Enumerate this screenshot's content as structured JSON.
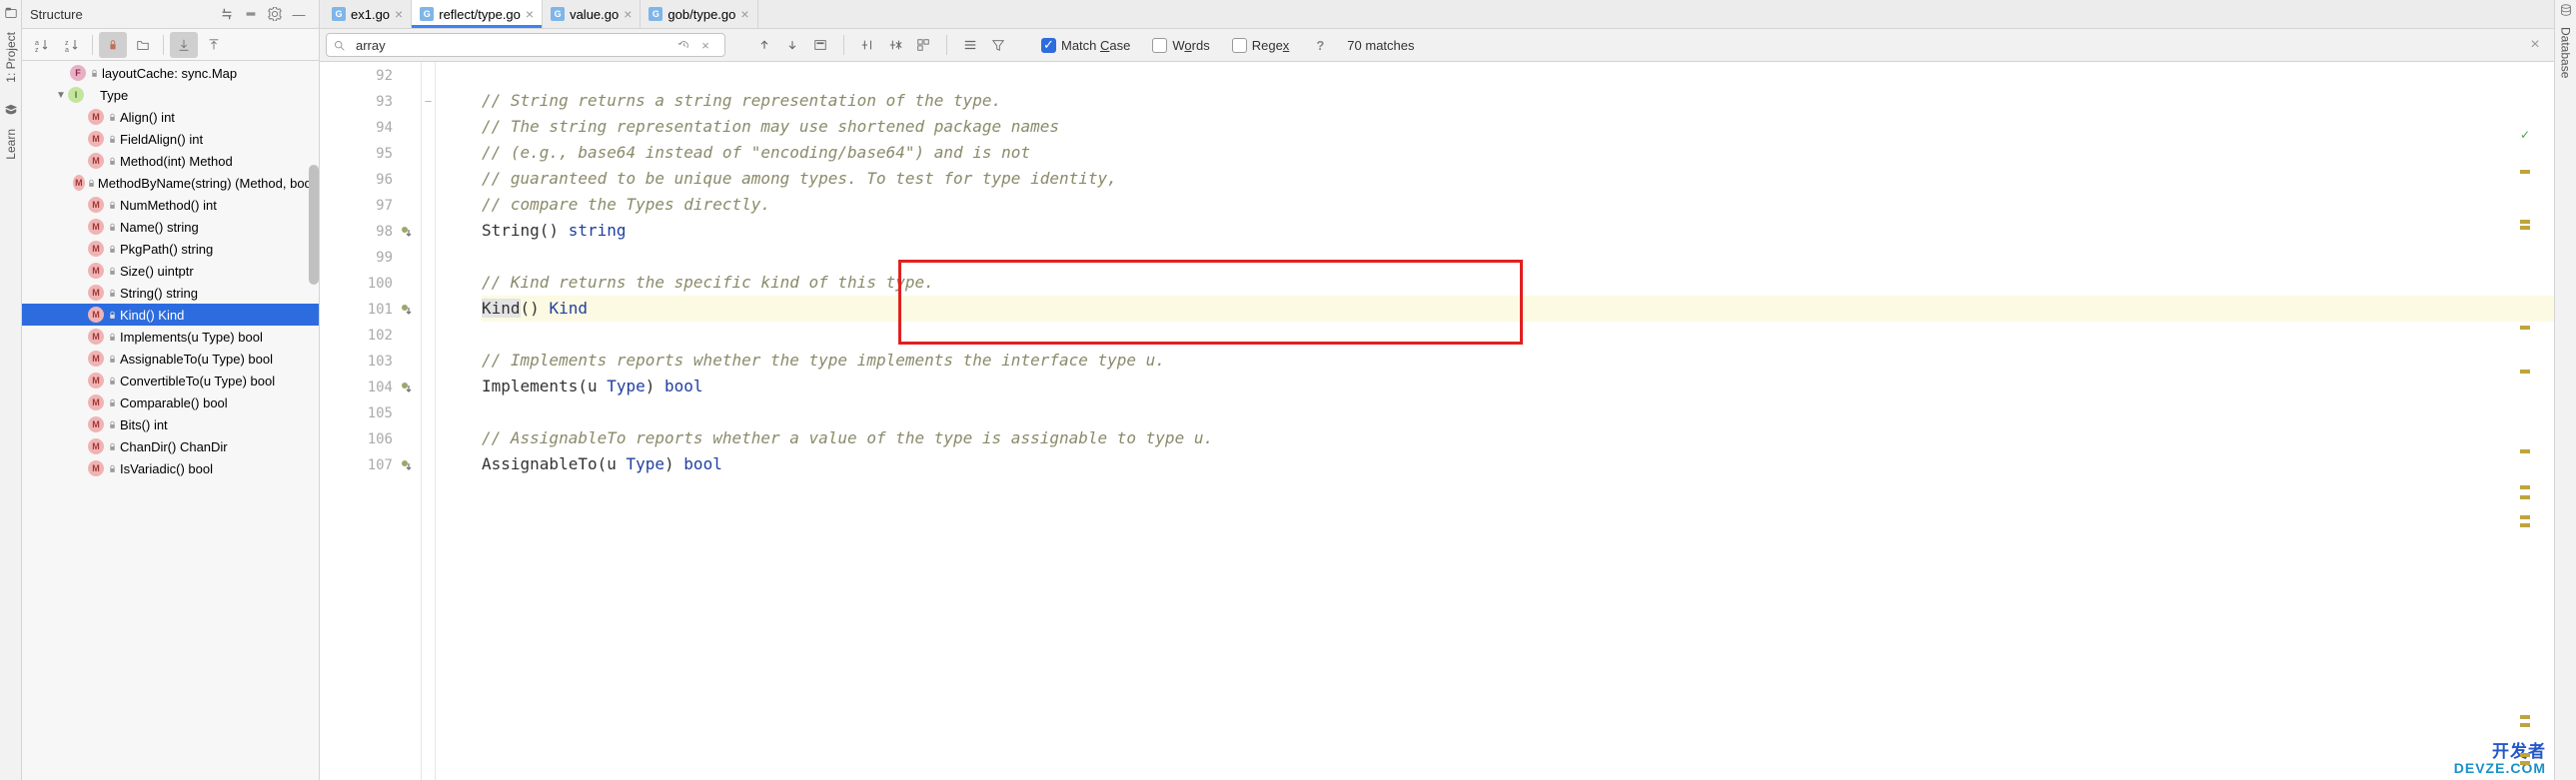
{
  "leftStrip": [
    "1: Project",
    "Learn"
  ],
  "rightStrip": [
    "Database"
  ],
  "structure": {
    "title": "Structure",
    "items": [
      {
        "indent": 28,
        "arrow": "",
        "icon": "f",
        "label": "layoutCache: sync.Map",
        "lock": true
      },
      {
        "indent": 26,
        "arrow": "▼",
        "icon": "i",
        "label": "Type",
        "lock": false
      },
      {
        "indent": 46,
        "arrow": "",
        "icon": "m",
        "label": "Align() int",
        "lock": true
      },
      {
        "indent": 46,
        "arrow": "",
        "icon": "m",
        "label": "FieldAlign() int",
        "lock": true
      },
      {
        "indent": 46,
        "arrow": "",
        "icon": "m",
        "label": "Method(int) Method",
        "lock": true
      },
      {
        "indent": 46,
        "arrow": "",
        "icon": "m",
        "label": "MethodByName(string) (Method, bool)",
        "lock": true
      },
      {
        "indent": 46,
        "arrow": "",
        "icon": "m",
        "label": "NumMethod() int",
        "lock": true
      },
      {
        "indent": 46,
        "arrow": "",
        "icon": "m",
        "label": "Name() string",
        "lock": true
      },
      {
        "indent": 46,
        "arrow": "",
        "icon": "m",
        "label": "PkgPath() string",
        "lock": true
      },
      {
        "indent": 46,
        "arrow": "",
        "icon": "m",
        "label": "Size() uintptr",
        "lock": true
      },
      {
        "indent": 46,
        "arrow": "",
        "icon": "m",
        "label": "String() string",
        "lock": true
      },
      {
        "indent": 46,
        "arrow": "",
        "icon": "m",
        "label": "Kind() Kind",
        "lock": true,
        "selected": true
      },
      {
        "indent": 46,
        "arrow": "",
        "icon": "m",
        "label": "Implements(u Type) bool",
        "lock": true
      },
      {
        "indent": 46,
        "arrow": "",
        "icon": "m",
        "label": "AssignableTo(u Type) bool",
        "lock": true
      },
      {
        "indent": 46,
        "arrow": "",
        "icon": "m",
        "label": "ConvertibleTo(u Type) bool",
        "lock": true
      },
      {
        "indent": 46,
        "arrow": "",
        "icon": "m",
        "label": "Comparable() bool",
        "lock": true
      },
      {
        "indent": 46,
        "arrow": "",
        "icon": "m",
        "label": "Bits() int",
        "lock": true
      },
      {
        "indent": 46,
        "arrow": "",
        "icon": "m",
        "label": "ChanDir() ChanDir",
        "lock": true
      },
      {
        "indent": 46,
        "arrow": "",
        "icon": "m",
        "label": "IsVariadic() bool",
        "lock": true
      }
    ]
  },
  "tabs": [
    {
      "label": "ex1.go",
      "active": false
    },
    {
      "label": "reflect/type.go",
      "active": true
    },
    {
      "label": "value.go",
      "active": false
    },
    {
      "label": "gob/type.go",
      "active": false
    }
  ],
  "search": {
    "query": "array",
    "matchCase": true,
    "words": false,
    "regex": false,
    "matchCaseLabel": "Match Case",
    "wordsLabel": "Words",
    "regexLabel": "Regex",
    "matches": "70 matches"
  },
  "gutter": [
    "92",
    "93",
    "94",
    "95",
    "96",
    "97",
    "98",
    "99",
    "100",
    "101",
    "102",
    "103",
    "104",
    "105",
    "106",
    "107"
  ],
  "gutterMarks": {
    "98": true,
    "101": true,
    "104": true,
    "107": true
  },
  "foldMarks": {
    "93": "−"
  },
  "code": [
    {
      "spans": []
    },
    {
      "spans": [
        {
          "t": "// String returns a string representation of the type.",
          "c": "comment"
        }
      ]
    },
    {
      "spans": [
        {
          "t": "// The string representation may use shortened package names",
          "c": "comment"
        }
      ]
    },
    {
      "spans": [
        {
          "t": "// (e.g., base64 instead of \"encoding/base64\") and is not",
          "c": "comment"
        }
      ]
    },
    {
      "spans": [
        {
          "t": "// guaranteed to be unique among types. To test for type identity,",
          "c": "comment"
        }
      ]
    },
    {
      "spans": [
        {
          "t": "// compare the Types directly.",
          "c": "comment"
        }
      ]
    },
    {
      "spans": [
        {
          "t": "String() ",
          "c": "ident"
        },
        {
          "t": "string",
          "c": "kw-type"
        }
      ]
    },
    {
      "spans": []
    },
    {
      "spans": [
        {
          "t": "// Kind returns the specific kind of this type.",
          "c": "comment"
        }
      ]
    },
    {
      "hl": true,
      "spans": [
        {
          "t": "Kind",
          "c": "ident",
          "sel": true
        },
        {
          "t": "() ",
          "c": "ident"
        },
        {
          "t": "Kind",
          "c": "kw-type"
        }
      ]
    },
    {
      "spans": []
    },
    {
      "spans": [
        {
          "t": "// Implements reports whether the type implements the interface type u.",
          "c": "comment"
        }
      ]
    },
    {
      "spans": [
        {
          "t": "Implements(u ",
          "c": "ident"
        },
        {
          "t": "Type",
          "c": "kw-type"
        },
        {
          "t": ") ",
          "c": "ident"
        },
        {
          "t": "bool",
          "c": "kw-type"
        }
      ]
    },
    {
      "spans": []
    },
    {
      "spans": [
        {
          "t": "// AssignableTo reports whether a value of the type is assignable to type u.",
          "c": "comment"
        }
      ]
    },
    {
      "spans": [
        {
          "t": "AssignableTo(u ",
          "c": "ident"
        },
        {
          "t": "Type",
          "c": "kw-type"
        },
        {
          "t": ") ",
          "c": "ident"
        },
        {
          "t": "bool",
          "c": "kw-type"
        }
      ]
    }
  ],
  "watermark": {
    "l1": "开发者",
    "l2": "DEVZE.COM"
  }
}
